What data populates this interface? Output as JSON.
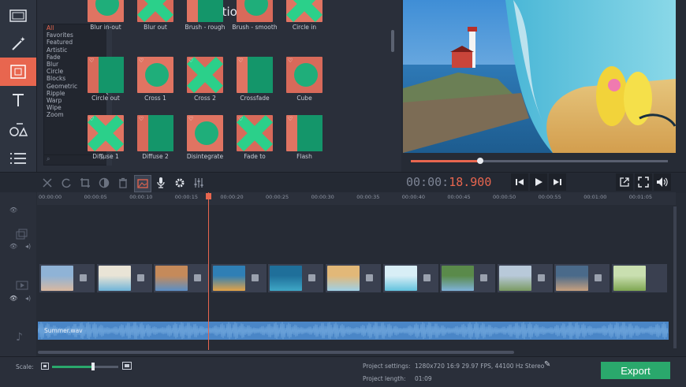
{
  "panel": {
    "title": "Transitions"
  },
  "categories": [
    "All",
    "Favorites",
    "Featured",
    "Artistic",
    "Fade",
    "Blur",
    "Circle",
    "Blocks",
    "Geometric",
    "Ripple",
    "Warp",
    "Wipe",
    "Zoom"
  ],
  "selected_category": "All",
  "transitions": [
    {
      "label": "Blur in-out"
    },
    {
      "label": "Blur out"
    },
    {
      "label": "Brush - rough"
    },
    {
      "label": "Brush - smooth"
    },
    {
      "label": "Circle in"
    },
    {
      "label": "Circle out"
    },
    {
      "label": "Cross 1"
    },
    {
      "label": "Cross 2"
    },
    {
      "label": "Crossfade"
    },
    {
      "label": "Cube"
    },
    {
      "label": "Diffuse 1"
    },
    {
      "label": "Diffuse 2"
    },
    {
      "label": "Disintegrate"
    },
    {
      "label": "Fade to"
    },
    {
      "label": "Flash"
    }
  ],
  "player": {
    "timecode_prefix": "00:00:",
    "timecode_active": "18.900",
    "progress": 0.27
  },
  "ruler": [
    "00:00:00",
    "00:00:05",
    "00:00:10",
    "00:00:15",
    "00:00:20",
    "00:00:25",
    "00:00:30",
    "00:00:35",
    "00:00:40",
    "00:00:45",
    "00:00:50",
    "00:00:55",
    "00:01:00",
    "00:01:05"
  ],
  "audio": {
    "label": "Summer.wav"
  },
  "bottom": {
    "scale_label": "Scale:",
    "settings_label": "Project settings:",
    "settings_value": "1280x720 16:9 29.97 FPS, 44100 Hz Stereo",
    "length_label": "Project length:",
    "length_value": "01:09",
    "export_label": "Export"
  },
  "colors": {
    "accent": "#e8664f",
    "export": "#2aa86c",
    "audio": "#4a86c7"
  }
}
